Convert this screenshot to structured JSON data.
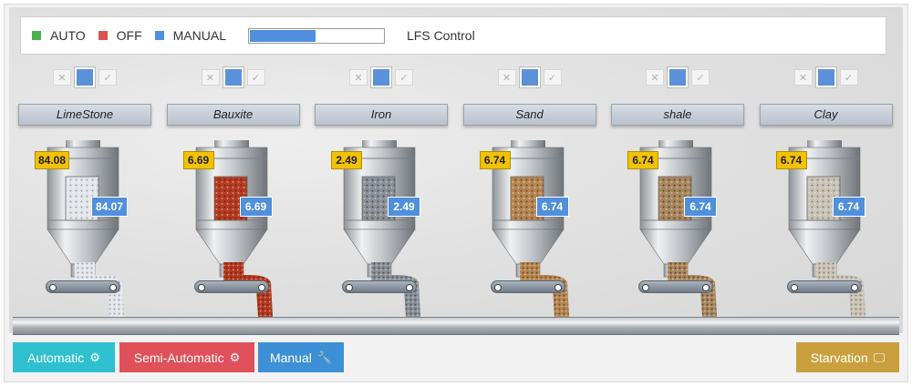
{
  "legend": [
    {
      "label": "AUTO",
      "color": "#4caf50"
    },
    {
      "label": "OFF",
      "color": "#d9534f"
    },
    {
      "label": "MANUAL",
      "color": "#4f8fde"
    }
  ],
  "progress": {
    "value": 0.5
  },
  "title": "LFS Control",
  "units": [
    {
      "name": "LimeStone",
      "top_value": "84.08",
      "side_value": "84.07",
      "material_color": "#e3e6ea",
      "speckle": "#9aa3ad"
    },
    {
      "name": "Bauxite",
      "top_value": "6.69",
      "side_value": "6.69",
      "material_color": "#b33b21",
      "speckle": "#7a1f10"
    },
    {
      "name": "Iron",
      "top_value": "2.49",
      "side_value": "2.49",
      "material_color": "#8b9096",
      "speckle": "#4b5056"
    },
    {
      "name": "Sand",
      "top_value": "6.74",
      "side_value": "6.74",
      "material_color": "#b58552",
      "speckle": "#6b4a26"
    },
    {
      "name": "shale",
      "top_value": "6.74",
      "side_value": "6.74",
      "material_color": "#a9875e",
      "speckle": "#5d4428"
    },
    {
      "name": "Clay",
      "top_value": "6.74",
      "side_value": "6.74",
      "material_color": "#c9c3b6",
      "speckle": "#8a8476"
    }
  ],
  "toggle_icons": {
    "off": "✕",
    "on": "✓"
  },
  "buttons": {
    "automatic": {
      "label": "Automatic",
      "icon": "cogs-icon",
      "glyph": "⚙",
      "color": "#2fc0cf"
    },
    "semi_automatic": {
      "label": "Semi-Automatic",
      "icon": "gear-icon",
      "glyph": "⚙",
      "color": "#e0505a"
    },
    "manual": {
      "label": "Manual",
      "icon": "wrench-icon",
      "glyph": "🔧",
      "color": "#3d8fd6"
    },
    "starvation": {
      "label": "Starvation",
      "icon": "monitor-icon",
      "glyph": "🖵",
      "color": "#c9a03d"
    }
  }
}
